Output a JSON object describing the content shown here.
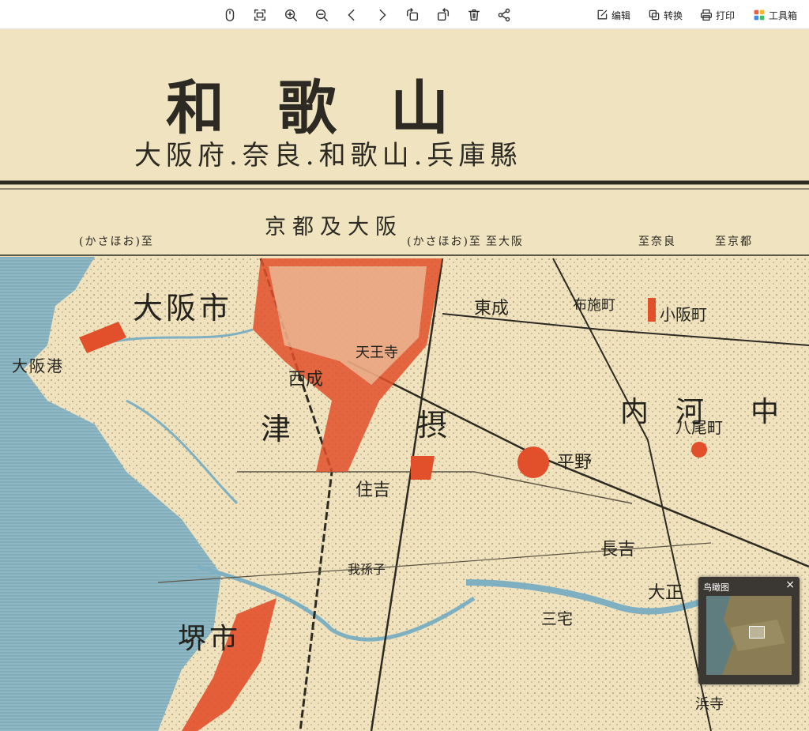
{
  "toolbar": {
    "icons": [
      "mouse-icon",
      "fit-screen-icon",
      "zoom-in-icon",
      "zoom-out-icon",
      "previous-icon",
      "next-icon",
      "rotate-left-icon",
      "rotate-right-icon",
      "delete-icon",
      "share-icon"
    ],
    "edit_label": "编辑",
    "convert_label": "转换",
    "print_label": "打印",
    "toolbox_label": "工具箱"
  },
  "map": {
    "title_main": "和歌山",
    "title_sub": "大阪府.奈良.和歌山.兵庫縣",
    "route_title": "京都及大阪",
    "margin_labels": [
      "至京都",
      "至奈良",
      "至大阪",
      "(かさほお)至",
      "(かさほお)至"
    ],
    "places": {
      "osaka": "大阪市",
      "sakai": "堺市",
      "tsu": "津",
      "setsu": "摂",
      "kawachi": "河",
      "uchi": "内",
      "naka": "中",
      "osaka_port": "大阪港",
      "kawachi_yao": "八尾町",
      "hirano": "平野",
      "nishinari": "西成",
      "higashinari": "東成",
      "sumiyoshi": "住吉",
      "minami_kawachi": "大正",
      "nagayoshi": "長吉",
      "fuse": "布施町",
      "kosaka": "小阪町",
      "mikuni": "三宅",
      "tennoji": "天王寺",
      "hanna": "浜寺",
      "kushiro": "我孫子"
    }
  },
  "birdview": {
    "title": "鸟瞰图",
    "close": "×"
  }
}
